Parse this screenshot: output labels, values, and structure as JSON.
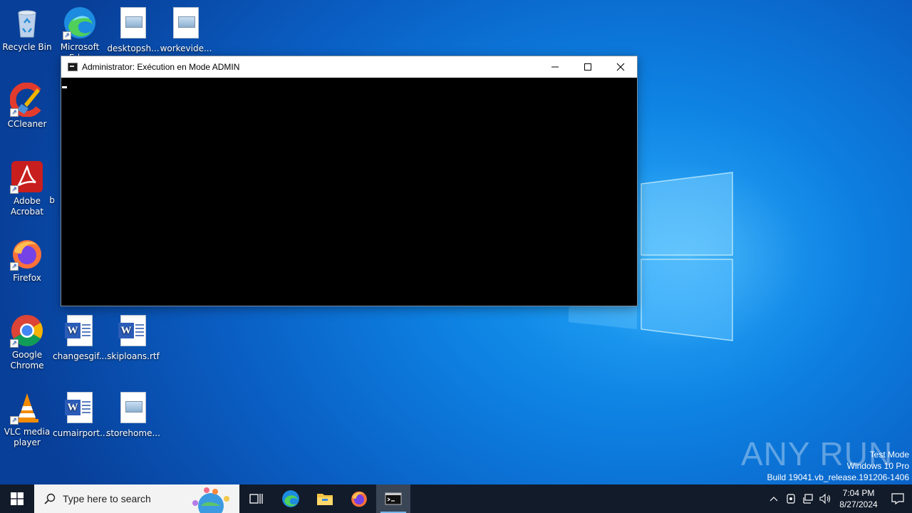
{
  "desktop": {
    "icons": [
      {
        "label": "Recycle Bin",
        "icon": "recycle-bin-icon"
      },
      {
        "label": "Microsoft Edge",
        "icon": "edge-icon"
      },
      {
        "label": "desktopsh...",
        "icon": "image-file-icon"
      },
      {
        "label": "workevide...",
        "icon": "image-file-icon"
      },
      {
        "label": "CCleaner",
        "icon": "ccleaner-icon"
      },
      {
        "label": "Adobe Acrobat",
        "icon": "acrobat-icon"
      },
      {
        "label": "Firefox",
        "icon": "firefox-icon"
      },
      {
        "label": "Google Chrome",
        "icon": "chrome-icon"
      },
      {
        "label": "changesgif...",
        "icon": "word-file-icon"
      },
      {
        "label": "skiploans.rtf",
        "icon": "word-file-icon"
      },
      {
        "label": "VLC media player",
        "icon": "vlc-icon"
      },
      {
        "label": "cumairport...",
        "icon": "word-file-icon"
      },
      {
        "label": "storehome...",
        "icon": "image-file-icon"
      }
    ],
    "hidden_label_fragment": "b"
  },
  "window": {
    "title": "Administrator:  Exécution en Mode ADMIN",
    "minimize_glyph": "—",
    "maximize_glyph": "☐",
    "close_glyph": "✕"
  },
  "watermark": {
    "brand": "ANY RUN",
    "line1": "Test Mode",
    "line2": "Windows 10 Pro",
    "line3": "Build 19041.vb_release.191206-1406"
  },
  "taskbar": {
    "search_placeholder": "Type here to search",
    "apps": [
      "task-view-icon",
      "edge-icon",
      "file-explorer-icon",
      "firefox-icon",
      "cmd-icon"
    ],
    "clock_time": "7:04 PM",
    "clock_date": "8/27/2024"
  },
  "colors": {
    "taskbar": "#121b2a",
    "desktop_blue": "#0d7fe0",
    "console_bg": "#000000"
  }
}
